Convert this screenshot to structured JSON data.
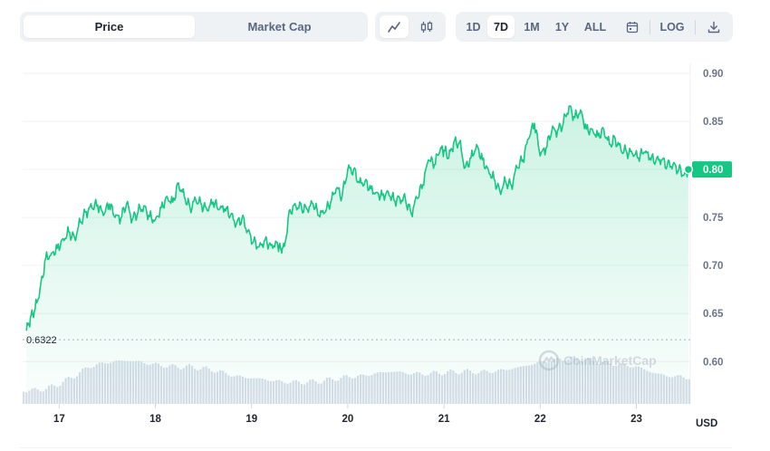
{
  "toolbar": {
    "type_tabs": [
      {
        "label": "Price",
        "active": true
      },
      {
        "label": "Market Cap",
        "active": false
      }
    ],
    "style_icons": [
      "line-chart-icon",
      "candlestick-icon"
    ],
    "ranges": [
      {
        "label": "1D",
        "active": false
      },
      {
        "label": "7D",
        "active": true
      },
      {
        "label": "1M",
        "active": false
      },
      {
        "label": "1Y",
        "active": false
      },
      {
        "label": "ALL",
        "active": false
      }
    ],
    "calendar_icon": "calendar-icon",
    "log_label": "LOG",
    "download_icon": "download-icon"
  },
  "watermark": {
    "text": "CoinMarketCap"
  },
  "colors": {
    "line": "#16c784",
    "area_top": "#16c784",
    "volume": "#cfd6e4",
    "grid": "#eff2f5"
  },
  "chart_data": {
    "type": "area",
    "currency": "USD",
    "open_price_label": "0.6322",
    "current_price_label": "0.80",
    "y_ticks": [
      "0.90",
      "0.85",
      "0.80",
      "0.75",
      "0.70",
      "0.65",
      "0.60"
    ],
    "ylim": [
      0.555,
      0.9
    ],
    "x_ticks": [
      "17",
      "18",
      "19",
      "20",
      "21",
      "22",
      "23"
    ],
    "x_tick_days": [
      17,
      18,
      19,
      20,
      21,
      22,
      23
    ],
    "xlim": [
      16.62,
      23.56
    ],
    "price_series": {
      "x": [
        16.66,
        16.7,
        16.75,
        16.8,
        16.86,
        16.92,
        16.98,
        17.04,
        17.1,
        17.16,
        17.22,
        17.28,
        17.34,
        17.4,
        17.46,
        17.52,
        17.58,
        17.64,
        17.7,
        17.76,
        17.82,
        17.88,
        17.94,
        18.0,
        18.06,
        18.12,
        18.18,
        18.24,
        18.3,
        18.36,
        18.42,
        18.48,
        18.54,
        18.6,
        18.66,
        18.72,
        18.78,
        18.84,
        18.9,
        18.96,
        19.02,
        19.08,
        19.14,
        19.2,
        19.26,
        19.3,
        19.34,
        19.4,
        19.46,
        19.52,
        19.58,
        19.64,
        19.7,
        19.76,
        19.82,
        19.88,
        19.94,
        20.0,
        20.06,
        20.12,
        20.18,
        20.24,
        20.3,
        20.36,
        20.42,
        20.48,
        20.54,
        20.6,
        20.66,
        20.72,
        20.78,
        20.84,
        20.9,
        20.96,
        21.0,
        21.05,
        21.1,
        21.16,
        21.22,
        21.28,
        21.34,
        21.4,
        21.46,
        21.52,
        21.58,
        21.64,
        21.7,
        21.76,
        21.82,
        21.88,
        21.94,
        22.0,
        22.06,
        22.12,
        22.18,
        22.24,
        22.3,
        22.36,
        22.42,
        22.48,
        22.54,
        22.6,
        22.66,
        22.72,
        22.78,
        22.84,
        22.9,
        22.96,
        23.02,
        23.08,
        23.14,
        23.2,
        23.26,
        23.32,
        23.38,
        23.44,
        23.5,
        23.54
      ],
      "y": [
        0.6322,
        0.645,
        0.655,
        0.675,
        0.708,
        0.713,
        0.718,
        0.728,
        0.735,
        0.729,
        0.745,
        0.756,
        0.76,
        0.763,
        0.752,
        0.764,
        0.75,
        0.749,
        0.764,
        0.748,
        0.756,
        0.762,
        0.751,
        0.748,
        0.76,
        0.772,
        0.766,
        0.786,
        0.772,
        0.76,
        0.768,
        0.763,
        0.757,
        0.766,
        0.758,
        0.759,
        0.752,
        0.743,
        0.749,
        0.736,
        0.725,
        0.72,
        0.727,
        0.721,
        0.724,
        0.718,
        0.72,
        0.758,
        0.762,
        0.76,
        0.758,
        0.764,
        0.752,
        0.755,
        0.765,
        0.78,
        0.772,
        0.8,
        0.8,
        0.786,
        0.788,
        0.78,
        0.776,
        0.773,
        0.777,
        0.768,
        0.77,
        0.768,
        0.754,
        0.77,
        0.784,
        0.81,
        0.805,
        0.82,
        0.82,
        0.812,
        0.828,
        0.828,
        0.802,
        0.812,
        0.826,
        0.81,
        0.8,
        0.79,
        0.778,
        0.787,
        0.783,
        0.802,
        0.81,
        0.832,
        0.848,
        0.814,
        0.822,
        0.84,
        0.84,
        0.848,
        0.866,
        0.854,
        0.862,
        0.842,
        0.842,
        0.835,
        0.842,
        0.826,
        0.832,
        0.82,
        0.818,
        0.816,
        0.812,
        0.818,
        0.812,
        0.808,
        0.81,
        0.804,
        0.805,
        0.8,
        0.795,
        0.8
      ]
    },
    "volume_series": {
      "x": [
        16.7,
        16.85,
        17.0,
        17.15,
        17.3,
        17.45,
        17.6,
        17.75,
        17.9,
        18.05,
        18.2,
        18.35,
        18.5,
        18.65,
        18.8,
        18.95,
        19.1,
        19.25,
        19.4,
        19.55,
        19.7,
        19.85,
        20.0,
        20.15,
        20.3,
        20.45,
        20.6,
        20.75,
        20.9,
        21.05,
        21.2,
        21.35,
        21.5,
        21.65,
        21.8,
        21.95,
        22.1,
        22.25,
        22.4,
        22.55,
        22.7,
        22.85,
        23.0,
        23.15,
        23.3,
        23.45,
        23.54
      ],
      "level": [
        0.3,
        0.33,
        0.45,
        0.62,
        0.82,
        0.9,
        0.95,
        0.95,
        0.9,
        0.85,
        0.82,
        0.82,
        0.78,
        0.72,
        0.62,
        0.58,
        0.55,
        0.5,
        0.48,
        0.48,
        0.5,
        0.55,
        0.6,
        0.62,
        0.68,
        0.72,
        0.68,
        0.66,
        0.68,
        0.7,
        0.72,
        0.7,
        0.72,
        0.76,
        0.82,
        0.9,
        0.96,
        1.0,
        1.0,
        0.95,
        0.9,
        0.85,
        0.82,
        0.7,
        0.62,
        0.6,
        0.58
      ]
    }
  }
}
